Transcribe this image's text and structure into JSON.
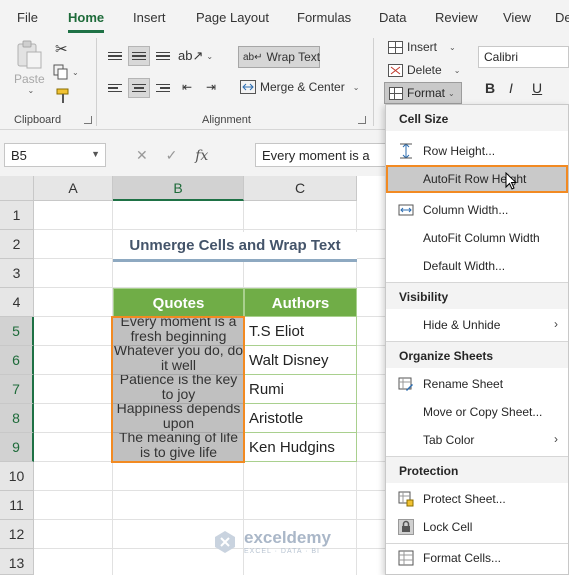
{
  "menubar": {
    "tabs": [
      "File",
      "Home",
      "Insert",
      "Page Layout",
      "Formulas",
      "Data",
      "Review",
      "View",
      "De"
    ],
    "active_tab": "Home"
  },
  "ribbon": {
    "clipboard": {
      "paste": "Paste",
      "label": "Clipboard"
    },
    "alignment": {
      "wrap_text": "Wrap Text",
      "merge_center": "Merge & Center",
      "label": "Alignment"
    },
    "cells": {
      "insert": "Insert",
      "delete": "Delete",
      "format": "Format"
    },
    "font": {
      "name": "Calibri",
      "bold": "B",
      "italic": "I",
      "underline": "U"
    }
  },
  "formula_bar": {
    "name_box": "B5",
    "fx": "fx",
    "formula": "Every moment is a"
  },
  "grid": {
    "columns": [
      "A",
      "B",
      "C"
    ],
    "rows": [
      "1",
      "2",
      "3",
      "4",
      "5",
      "6",
      "7",
      "8",
      "9",
      "10",
      "11",
      "12",
      "13"
    ],
    "title": "Unmerge Cells and Wrap Text",
    "headers": {
      "quotes": "Quotes",
      "authors": "Authors"
    },
    "quotes": [
      "Every moment is a fresh beginning",
      "Whatever you do, do it well",
      "Patience is the key to joy",
      "Happiness depends upon",
      "The meaning of life is to give life"
    ],
    "authors": [
      "T.S Eliot",
      "Walt Disney",
      "Rumi",
      "Aristotle",
      "Ken Hudgins"
    ]
  },
  "format_menu": {
    "cell_size": {
      "title": "Cell Size",
      "row_height": "Row Height...",
      "autofit_row_height": "AutoFit Row Height",
      "column_width": "Column Width...",
      "autofit_column_width": "AutoFit Column Width",
      "default_width": "Default Width..."
    },
    "visibility": {
      "title": "Visibility",
      "hide_unhide": "Hide & Unhide"
    },
    "organize": {
      "title": "Organize Sheets",
      "rename": "Rename Sheet",
      "move_copy": "Move or Copy Sheet...",
      "tab_color": "Tab Color"
    },
    "protection": {
      "title": "Protection",
      "protect": "Protect Sheet...",
      "lock": "Lock Cell",
      "format_cells": "Format Cells..."
    }
  },
  "watermark": {
    "name": "exceldemy",
    "tagline": "EXCEL · DATA · BI"
  },
  "colors": {
    "excel_green": "#1e7145",
    "header_green": "#70ad47",
    "selection_orange": "#f28a22",
    "title_color": "#44546a"
  }
}
